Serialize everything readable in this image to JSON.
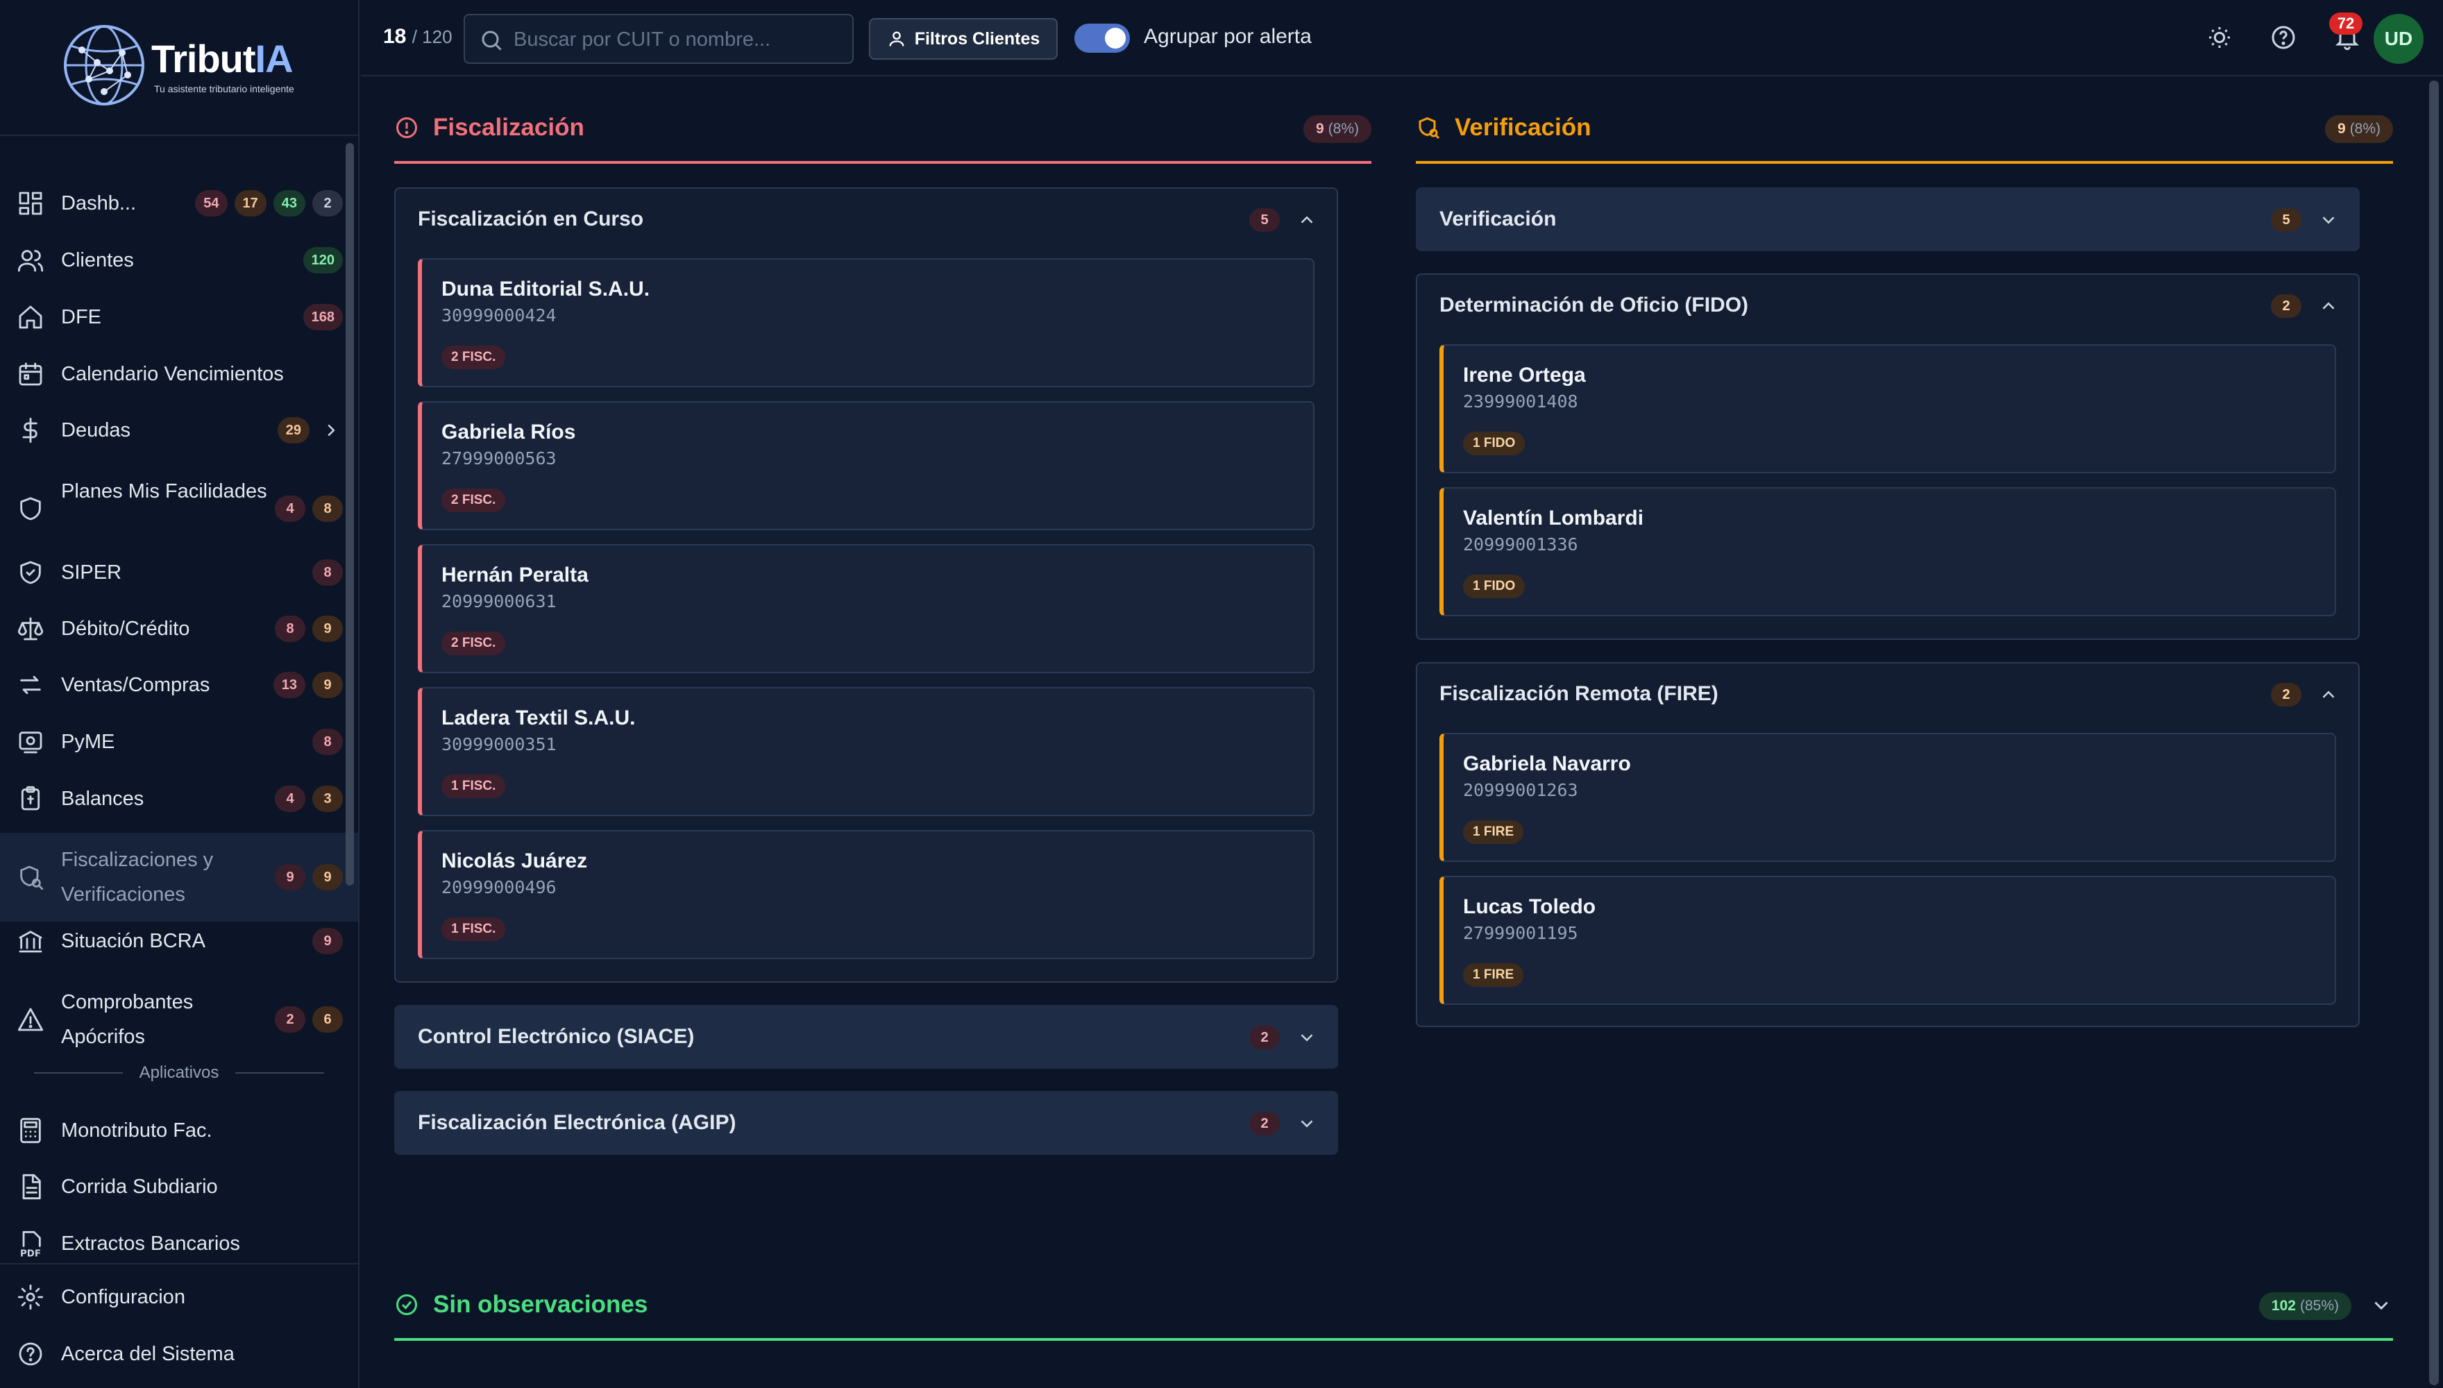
{
  "brand": {
    "name_main": "Tribut",
    "name_accent": "IA",
    "tagline": "Tu asistente tributario inteligente"
  },
  "sidebar": {
    "items": [
      {
        "label": "Dashb...",
        "icon": "dashboard-icon",
        "badges": [
          {
            "v": "54",
            "c": "red"
          },
          {
            "v": "17",
            "c": "orange"
          },
          {
            "v": "43",
            "c": "green"
          },
          {
            "v": "2",
            "c": "gray"
          }
        ]
      },
      {
        "label": "Clientes",
        "icon": "users-icon",
        "badges": [
          {
            "v": "120",
            "c": "green"
          }
        ]
      },
      {
        "label": "DFE",
        "icon": "home-icon",
        "badges": [
          {
            "v": "168",
            "c": "red"
          }
        ]
      },
      {
        "label": "Calendario Vencimientos",
        "icon": "calendar-icon",
        "badges": []
      },
      {
        "label": "Deudas",
        "icon": "dollar-icon",
        "badges": [
          {
            "v": "29",
            "c": "orange"
          }
        ],
        "chevron": true
      },
      {
        "label": "Planes Mis Facilidades",
        "icon": "shield-icon",
        "badges": [
          {
            "v": "4",
            "c": "red"
          },
          {
            "v": "8",
            "c": "orange"
          }
        ]
      },
      {
        "label": "SIPER",
        "icon": "shield-check-icon",
        "badges": [
          {
            "v": "8",
            "c": "red"
          }
        ]
      },
      {
        "label": "Débito/Crédito",
        "icon": "scale-icon",
        "badges": [
          {
            "v": "8",
            "c": "red"
          },
          {
            "v": "9",
            "c": "orange"
          }
        ]
      },
      {
        "label": "Ventas/Compras",
        "icon": "arrows-icon",
        "badges": [
          {
            "v": "13",
            "c": "red"
          },
          {
            "v": "9",
            "c": "orange"
          }
        ]
      },
      {
        "label": "PyME",
        "icon": "pyme-icon",
        "badges": [
          {
            "v": "8",
            "c": "red"
          }
        ]
      },
      {
        "label": "Balances",
        "icon": "clipboard-icon",
        "badges": [
          {
            "v": "4",
            "c": "red"
          },
          {
            "v": "3",
            "c": "orange"
          }
        ]
      },
      {
        "label": "Fiscalizaciones y Verificaciones",
        "icon": "search-shield-icon",
        "badges": [
          {
            "v": "9",
            "c": "red"
          },
          {
            "v": "9",
            "c": "orange"
          }
        ],
        "active": true
      },
      {
        "label": "Situación BCRA",
        "icon": "bank-icon",
        "badges": [
          {
            "v": "9",
            "c": "red"
          }
        ]
      },
      {
        "label": "Comprobantes Apócrifos",
        "icon": "warning-icon",
        "badges": [
          {
            "v": "2",
            "c": "red"
          },
          {
            "v": "6",
            "c": "orange"
          }
        ]
      }
    ],
    "section_label": "Aplicativos",
    "apps": [
      {
        "label": "Monotributo Fac.",
        "icon": "calculator-icon"
      },
      {
        "label": "Corrida Subdiario",
        "icon": "document-icon"
      },
      {
        "label": "Extractos Bancarios",
        "icon": "pdf-icon"
      }
    ],
    "bottom": [
      {
        "label": "Configuracion",
        "icon": "gear-icon"
      },
      {
        "label": "Acerca del Sistema",
        "icon": "help-icon"
      }
    ]
  },
  "topbar": {
    "count_shown": "18",
    "count_total": "/ 120",
    "search_placeholder": "Buscar por CUIT o nombre...",
    "filter_label": "Filtros Clientes",
    "toggle_label": "Agrupar por alerta",
    "notifications": "72",
    "avatar": "UD"
  },
  "colors": {
    "red": "#f2707a",
    "orange": "#f59e0b",
    "green": "#4ade80",
    "bg": "#0c1527"
  },
  "sections": {
    "fiscalizacion": {
      "title": "Fiscalización",
      "count": "9",
      "pct": "(8%)",
      "groups": [
        {
          "title": "Fiscalización en Curso",
          "count": "5",
          "expanded": true,
          "cards": [
            {
              "name": "Duna Editorial S.A.U.",
              "cuit": "30999000424",
              "tag": "2 FISC."
            },
            {
              "name": "Gabriela Ríos",
              "cuit": "27999000563",
              "tag": "2 FISC."
            },
            {
              "name": "Hernán Peralta",
              "cuit": "20999000631",
              "tag": "2 FISC."
            },
            {
              "name": "Ladera Textil S.A.U.",
              "cuit": "30999000351",
              "tag": "1 FISC."
            },
            {
              "name": "Nicolás Juárez",
              "cuit": "20999000496",
              "tag": "1 FISC."
            }
          ]
        },
        {
          "title": "Control Electrónico (SIACE)",
          "count": "2",
          "expanded": false,
          "cards": []
        },
        {
          "title": "Fiscalización Electrónica (AGIP)",
          "count": "2",
          "expanded": false,
          "cards": []
        }
      ]
    },
    "verificacion": {
      "title": "Verificación",
      "count": "9",
      "pct": "(8%)",
      "groups": [
        {
          "title": "Verificación",
          "count": "5",
          "expanded": false,
          "cards": []
        },
        {
          "title": "Determinación de Oficio (FIDO)",
          "count": "2",
          "expanded": true,
          "cards": [
            {
              "name": "Irene Ortega",
              "cuit": "23999001408",
              "tag": "1 FIDO"
            },
            {
              "name": "Valentín Lombardi",
              "cuit": "20999001336",
              "tag": "1 FIDO"
            }
          ]
        },
        {
          "title": "Fiscalización Remota (FIRE)",
          "count": "2",
          "expanded": true,
          "cards": [
            {
              "name": "Gabriela Navarro",
              "cuit": "20999001263",
              "tag": "1 FIRE"
            },
            {
              "name": "Lucas Toledo",
              "cuit": "27999001195",
              "tag": "1 FIRE"
            }
          ]
        }
      ]
    },
    "sin_observaciones": {
      "title": "Sin observaciones",
      "count": "102",
      "pct": "(85%)"
    }
  }
}
